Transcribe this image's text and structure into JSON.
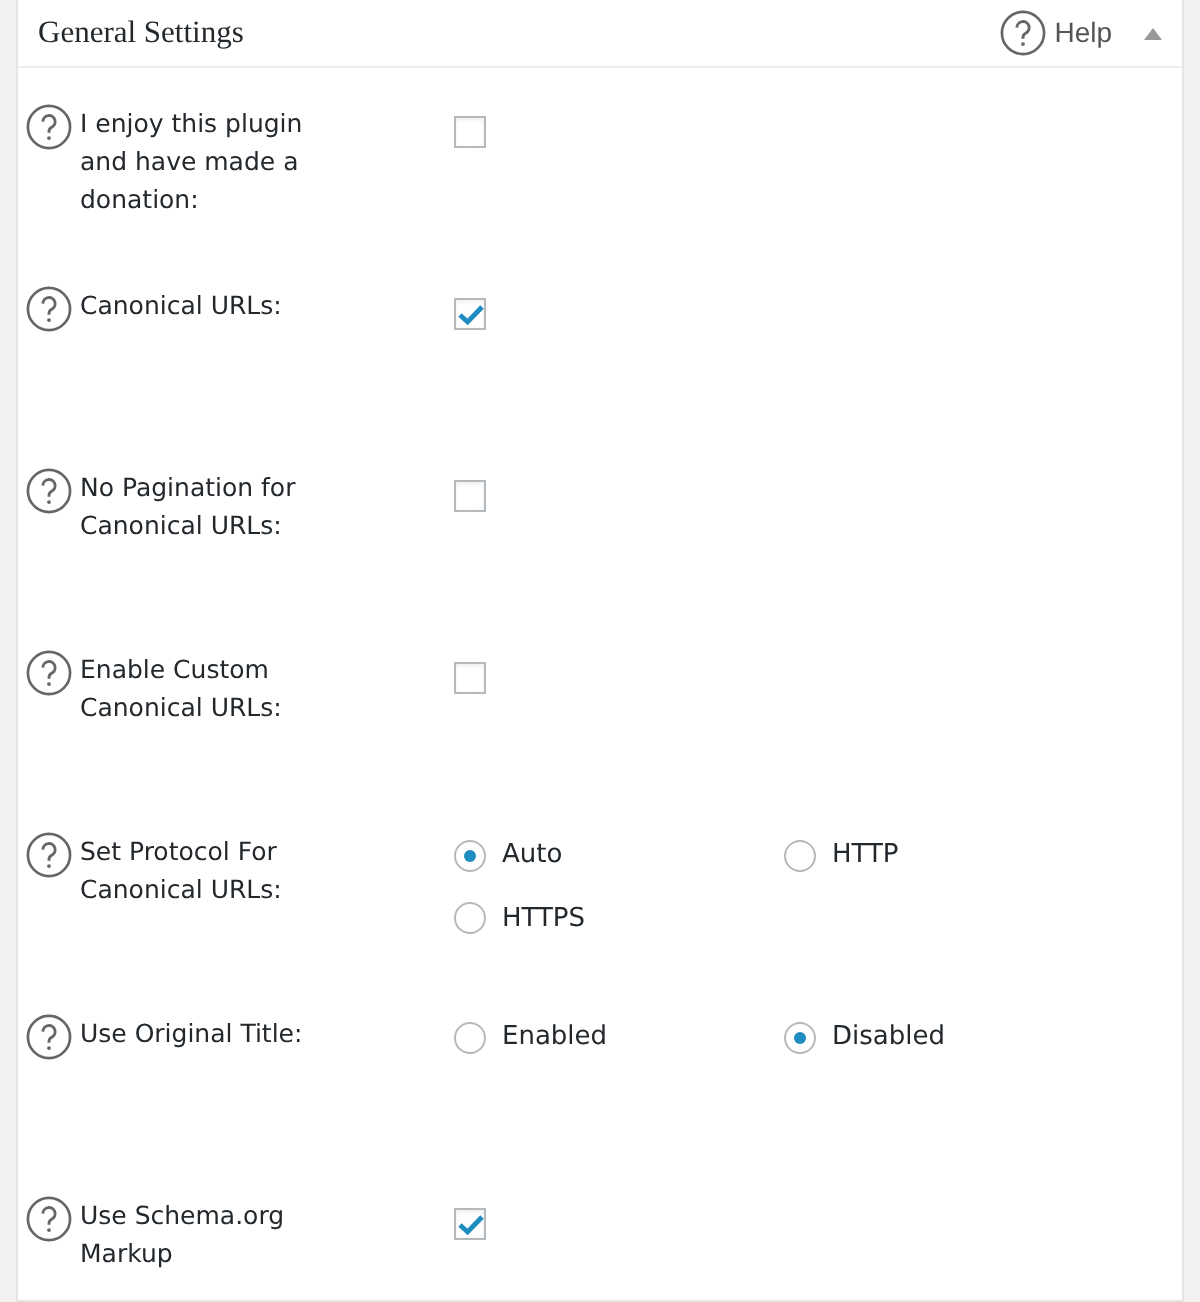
{
  "panel": {
    "title": "General Settings",
    "help_label": "Help"
  },
  "settings": [
    {
      "label": "I enjoy this plugin and have made a donation:",
      "kind": "checkbox",
      "checked": false
    },
    {
      "label": "Canonical URLs:",
      "kind": "checkbox",
      "checked": true
    },
    {
      "label": "No Pagination for Canonical URLs:",
      "kind": "checkbox",
      "checked": false
    },
    {
      "label": "Enable Custom Canonical URLs:",
      "kind": "checkbox",
      "checked": false
    },
    {
      "label": "Set Protocol For Canonical URLs:",
      "kind": "radio",
      "options": [
        {
          "label": "Auto",
          "selected": true
        },
        {
          "label": "HTTP",
          "selected": false
        },
        {
          "label": "HTTPS",
          "selected": false
        }
      ]
    },
    {
      "label": "Use Original Title:",
      "kind": "radio",
      "options": [
        {
          "label": "Enabled",
          "selected": false
        },
        {
          "label": "Disabled",
          "selected": true
        }
      ]
    },
    {
      "label": "Use Schema.org Markup",
      "kind": "checkbox",
      "checked": true
    }
  ]
}
